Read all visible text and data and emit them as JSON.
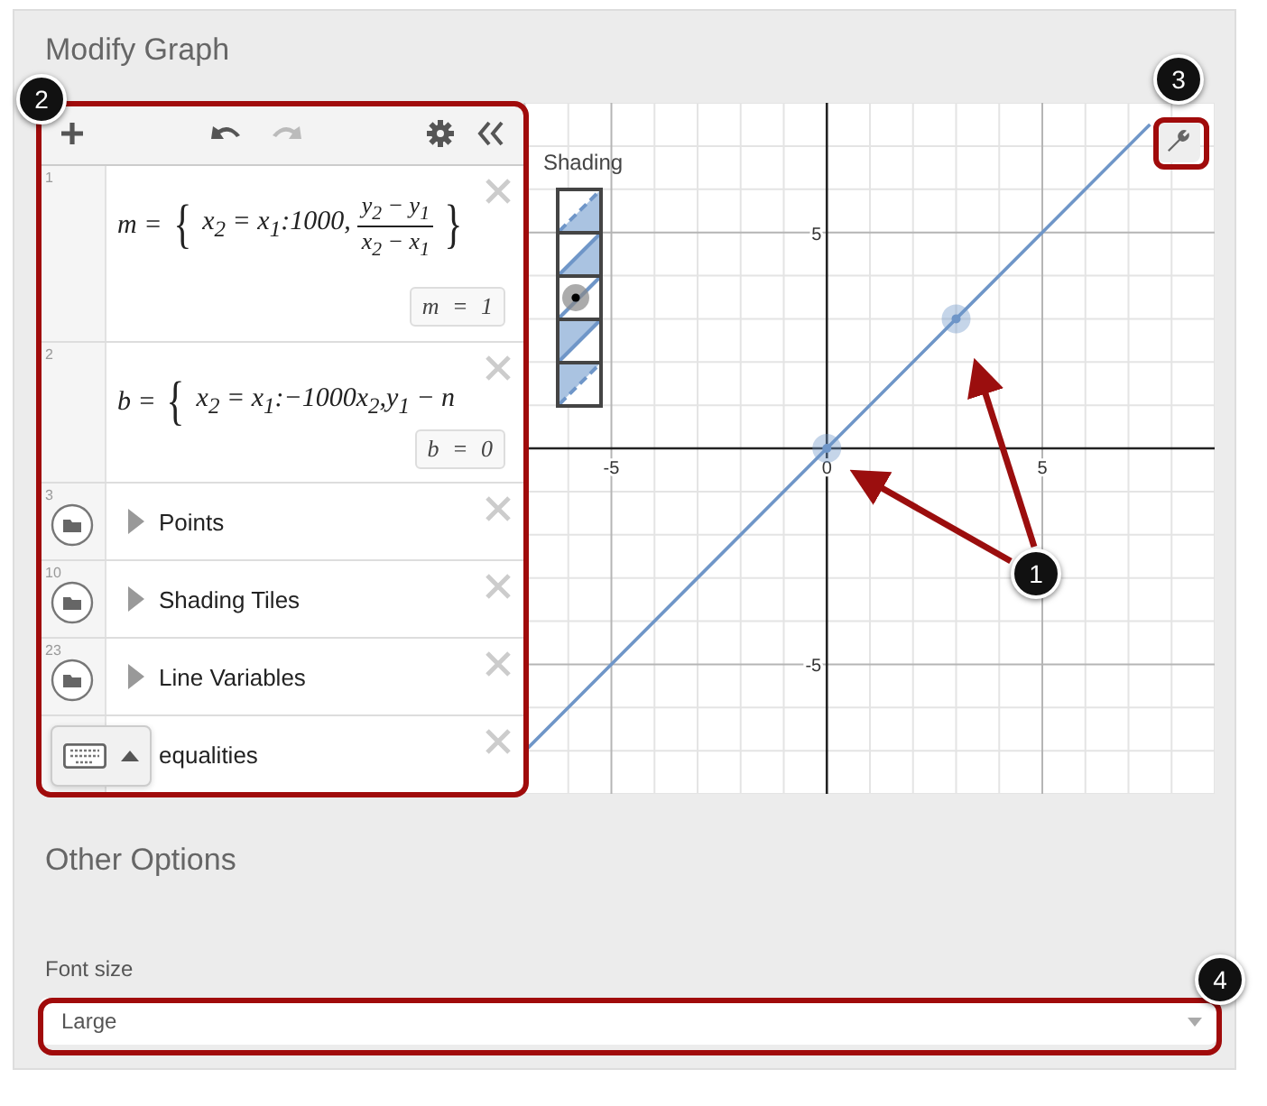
{
  "title": "Modify Graph",
  "toolbar": {
    "undo_disabled": false,
    "redo_disabled": true
  },
  "expressions": [
    {
      "kind": "expression",
      "number": "1",
      "lhs": "m =",
      "open": "{",
      "body": "x$_{2}$ = x$_{1}$:1000,",
      "fraction": {
        "num": "y$_{2}$ − y$_{1}$",
        "den": "x$_{2}$ − x$_{1}$"
      },
      "close": "}",
      "value": "m = 1"
    },
    {
      "kind": "expression",
      "number": "2",
      "lhs": "b =",
      "open": "{",
      "body": "x$_{2}$ = x$_{1}$:−1000x$_{2}$,y$_{1}$ − n",
      "value": "b = 0"
    },
    {
      "kind": "folder",
      "number": "3",
      "label": "Points",
      "expanded": false
    },
    {
      "kind": "folder",
      "number": "10",
      "label": "Shading Tiles",
      "expanded": false
    },
    {
      "kind": "folder",
      "number": "23",
      "label": "Line Variables",
      "expanded": false
    },
    {
      "kind": "folder",
      "label": "equalities"
    }
  ],
  "graph": {
    "legend": {
      "title": "Shading",
      "tiles": [
        {
          "kind": "below",
          "dashed": true,
          "selected": false
        },
        {
          "kind": "below",
          "dashed": false,
          "selected": false
        },
        {
          "kind": "plain",
          "dashed": false,
          "selected": true
        },
        {
          "kind": "above",
          "dashed": false,
          "selected": false
        },
        {
          "kind": "above",
          "dashed": true,
          "selected": false
        }
      ]
    },
    "chart_data": {
      "type": "line",
      "grid": true,
      "x": [
        -7,
        0,
        3,
        7.5
      ],
      "xlim": [
        -7,
        9
      ],
      "ylim": [
        -8,
        8
      ],
      "xticks": [
        -5,
        0,
        5
      ],
      "yticks": [
        -5,
        5
      ],
      "series": [
        {
          "color": "#6f96c8",
          "values": [
            -7,
            0,
            3,
            7.5
          ]
        }
      ]
    }
  },
  "other_options": {
    "heading": "Other Options",
    "font_size": {
      "label": "Font size",
      "value": "Large"
    }
  },
  "callouts": [
    {
      "number": "1"
    },
    {
      "number": "2"
    },
    {
      "number": "3"
    },
    {
      "number": "4"
    }
  ]
}
